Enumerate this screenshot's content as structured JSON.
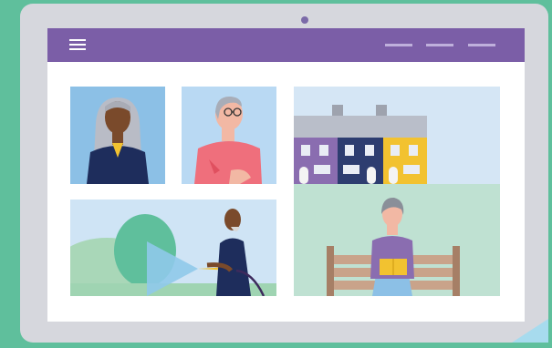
{
  "device": {
    "type": "laptop",
    "frame_color": "#d6d7dd",
    "background_color": "#5fbf9c"
  },
  "header": {
    "bar_color": "#7b5ea7",
    "menu_icon": "hamburger-menu-icon",
    "nav_items": [
      "",
      "",
      ""
    ]
  },
  "gallery": {
    "tiles": [
      {
        "subject": "woman-portrait",
        "background": "#8cc0e6"
      },
      {
        "subject": "man-with-glasses-portrait",
        "background": "#b9d9f3"
      },
      {
        "subject": "terraced-houses",
        "background": "#d5e6f5"
      },
      {
        "subject": "man-watering-garden",
        "background": "#cfe4f5"
      },
      {
        "subject": "woman-reading-on-bench",
        "background": "#bfe1d2"
      }
    ]
  }
}
